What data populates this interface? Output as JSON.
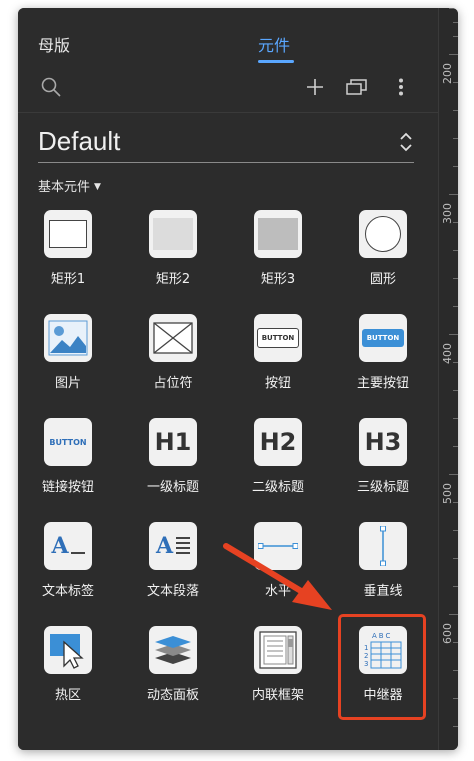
{
  "tabs": [
    {
      "label": "母版"
    },
    {
      "label": "元件"
    }
  ],
  "library": {
    "selected": "Default"
  },
  "section": {
    "label": "基本元件"
  },
  "widgets": [
    {
      "label": "矩形1",
      "icon": "rectangle-icon"
    },
    {
      "label": "矩形2",
      "icon": "rectangle-gray-icon"
    },
    {
      "label": "矩形3",
      "icon": "rectangle-dark-icon"
    },
    {
      "label": "圆形",
      "icon": "circle-icon"
    },
    {
      "label": "图片",
      "icon": "image-icon"
    },
    {
      "label": "占位符",
      "icon": "placeholder-icon"
    },
    {
      "label": "按钮",
      "icon": "button-icon",
      "text": "BUTTON"
    },
    {
      "label": "主要按钮",
      "icon": "primary-button-icon",
      "text": "BUTTON"
    },
    {
      "label": "链接按钮",
      "icon": "link-button-icon",
      "text": "BUTTON"
    },
    {
      "label": "一级标题",
      "icon": "heading1-icon",
      "text": "H1"
    },
    {
      "label": "二级标题",
      "icon": "heading2-icon",
      "text": "H2"
    },
    {
      "label": "三级标题",
      "icon": "heading3-icon",
      "text": "H3"
    },
    {
      "label": "文本标签",
      "icon": "text-label-icon",
      "text": "A"
    },
    {
      "label": "文本段落",
      "icon": "text-paragraph-icon",
      "text": "A"
    },
    {
      "label": "水平",
      "icon": "horizontal-line-icon"
    },
    {
      "label": "垂直线",
      "icon": "vertical-line-icon"
    },
    {
      "label": "热区",
      "icon": "hotspot-icon"
    },
    {
      "label": "动态面板",
      "icon": "dynamic-panel-icon"
    },
    {
      "label": "内联框架",
      "icon": "inline-frame-icon"
    },
    {
      "label": "中继器",
      "icon": "repeater-icon",
      "text": "ABC"
    }
  ],
  "ruler": {
    "labels": [
      "200",
      "300",
      "400",
      "500",
      "600"
    ]
  },
  "colors": {
    "accent": "#5aa7ff",
    "highlight": "#e64222",
    "panel": "#2c2c2c",
    "primary_button": "#3b8fd6"
  }
}
